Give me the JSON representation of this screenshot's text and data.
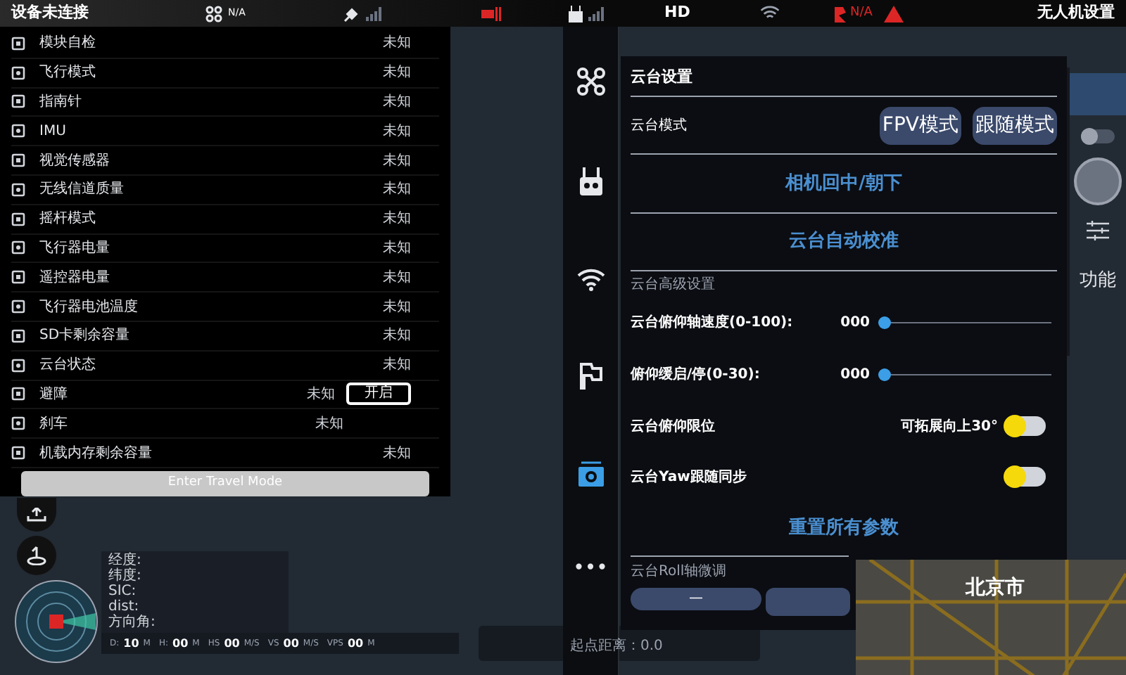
{
  "status_bar": {
    "connection": "设备未连接",
    "aircraft_status": "N/A",
    "video_link": "HD",
    "rtk_status": "N/A",
    "settings_title": "无人机设置"
  },
  "checklist": {
    "items": [
      {
        "kind": "status",
        "label": "模块自检",
        "value": "未知"
      },
      {
        "kind": "status",
        "label": "飞行模式",
        "value": "未知"
      },
      {
        "kind": "status",
        "label": "指南针",
        "value": "未知"
      },
      {
        "kind": "status",
        "label": "IMU",
        "value": "未知"
      },
      {
        "kind": "status",
        "label": "视觉传感器",
        "value": "未知"
      },
      {
        "kind": "status",
        "label": "无线信道质量",
        "value": "未知"
      },
      {
        "kind": "status",
        "label": "摇杆模式",
        "value": "未知"
      },
      {
        "kind": "status",
        "label": "飞行器电量",
        "value": "未知"
      },
      {
        "kind": "status",
        "label": "遥控器电量",
        "value": "未知"
      },
      {
        "kind": "status",
        "label": "飞行器电池温度",
        "value": "未知"
      },
      {
        "kind": "status",
        "label": "SD卡剩余容量",
        "value": "未知"
      },
      {
        "kind": "status",
        "label": "云台状态",
        "value": "未知"
      },
      {
        "kind": "toggle",
        "label": "避障",
        "value": "未知",
        "action": "开启"
      },
      {
        "kind": "plain",
        "label": "刹车",
        "value": "未知"
      },
      {
        "kind": "status",
        "label": "机载内存剩余容量",
        "value": "未知"
      }
    ],
    "travel_mode_button": "Enter Travel Mode"
  },
  "telemetry": {
    "labels": [
      "经度:",
      "纬度:",
      "SIC:",
      "dist:",
      "方向角:"
    ],
    "readings": [
      {
        "label": "D:",
        "value": "10",
        "unit": "M"
      },
      {
        "label": "H:",
        "value": "00",
        "unit": "M"
      },
      {
        "label": "HS",
        "value": "00",
        "unit": "M/S"
      },
      {
        "label": "VS",
        "value": "00",
        "unit": "M/S"
      },
      {
        "label": "VPS",
        "value": "00",
        "unit": "M"
      }
    ],
    "distance": "起点距离：0.0"
  },
  "side_nav": [
    {
      "kind": "drone",
      "selected": false
    },
    {
      "kind": "remote",
      "selected": false
    },
    {
      "kind": "wifi",
      "selected": false
    },
    {
      "kind": "battery",
      "selected": false
    },
    {
      "kind": "camera",
      "selected": true
    },
    {
      "kind": "more",
      "label": "•••",
      "selected": false
    }
  ],
  "gimbal": {
    "title": "云台设置",
    "mode_label": "云台模式",
    "modes": [
      {
        "label": "FPV模式",
        "selected": false
      },
      {
        "label": "跟随模式",
        "selected": false
      }
    ],
    "center_action": "相机回中/朝下",
    "calibrate_action": "云台自动校准",
    "advanced_title": "云台高级设置",
    "sliders": [
      {
        "label": "云台俯仰轴速度(0-100):",
        "value": "000",
        "level": 0
      },
      {
        "label": "俯仰缓启/停(0-30):",
        "value": "000",
        "level": 0
      }
    ],
    "toggles": [
      {
        "label": "云台俯仰限位",
        "note": "可拓展向上30°",
        "on": false
      },
      {
        "label": "云台Yaw跟随同步",
        "on": false
      }
    ],
    "reset_action": "重置所有参数",
    "roll_title": "云台Roll轴微调",
    "roll_buttons": [
      "—"
    ]
  },
  "rail": {
    "function_label": "功能",
    "mode_switch_on": false
  },
  "map": {
    "city": "北京市"
  }
}
